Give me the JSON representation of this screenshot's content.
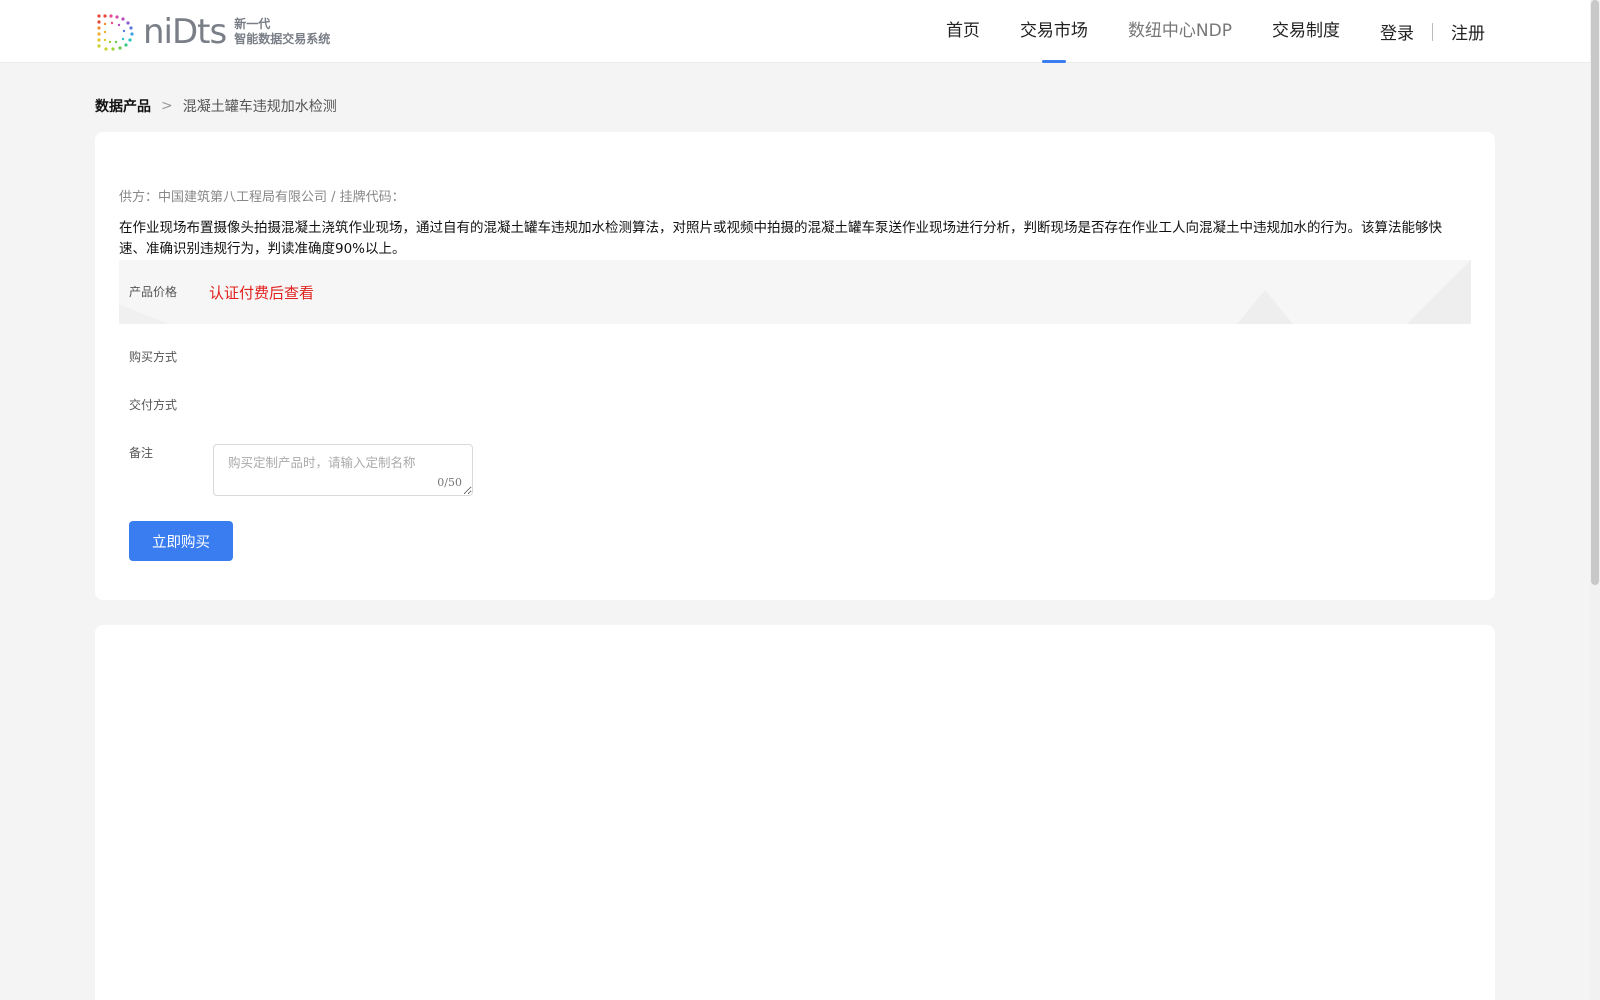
{
  "logo": {
    "word": "niDts",
    "sub_line1": "新一代",
    "sub_line2": "智能数据交易系统"
  },
  "nav": {
    "items": [
      {
        "label": "首页"
      },
      {
        "label": "交易市场"
      },
      {
        "label": "数纽中心NDP"
      },
      {
        "label": "交易制度"
      }
    ],
    "login": "登录",
    "register": "注册"
  },
  "breadcrumb": {
    "root": "数据产品",
    "separator": ">",
    "current": "混凝土罐车违规加水检测"
  },
  "product": {
    "supplier_line": "供方：中国建筑第八工程局有限公司 / 挂牌代码：",
    "description": "在作业现场布置摄像头拍摄混凝土浇筑作业现场，通过自有的混凝土罐车违规加水检测算法，对照片或视频中拍摄的混凝土罐车泵送作业现场进行分析，判断现场是否存在作业工人向混凝土中违规加水的行为。该算法能够快速、准确识别违规行为，判读准确度90%以上。",
    "price_label": "产品价格",
    "price_value": "认证付费后查看",
    "purchase_label": "购买方式",
    "delivery_label": "交付方式",
    "remark_label": "备注",
    "remark_placeholder": "购买定制产品时，请输入定制名称",
    "remark_count": "0/50",
    "buy_button": "立即购买"
  },
  "colors": {
    "accent": "#3a7df0",
    "price_red": "#e0201c",
    "page_bg": "#f4f4f4"
  }
}
